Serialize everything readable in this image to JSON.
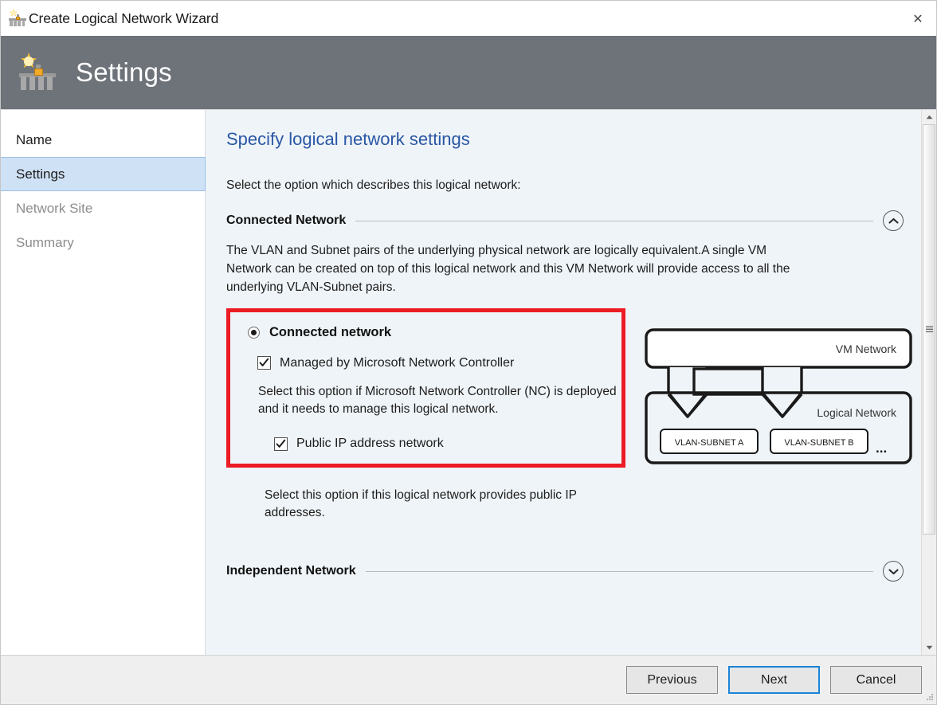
{
  "window": {
    "title": "Create Logical Network Wizard",
    "app_icon": "network-wizard-icon",
    "close_label": "✕"
  },
  "header": {
    "title": "Settings",
    "icon": "network-wizard-icon"
  },
  "sidebar": {
    "items": [
      {
        "label": "Name",
        "state": "enabled"
      },
      {
        "label": "Settings",
        "state": "selected"
      },
      {
        "label": "Network Site",
        "state": "disabled"
      },
      {
        "label": "Summary",
        "state": "disabled"
      }
    ]
  },
  "main": {
    "page_title": "Specify logical network settings",
    "intro": "Select the option which describes this logical network:",
    "connected_section": {
      "heading": "Connected Network",
      "collapse_icon": "chevron-up-icon",
      "description": "The VLAN and Subnet pairs of the underlying physical network are logically equivalent.A single VM Network can be created on top of this logical network and this VM Network will provide access to all the underlying VLAN-Subnet pairs.",
      "radio": {
        "label": "Connected network",
        "checked": true
      },
      "checkbox_managed": {
        "label": "Managed by Microsoft Network Controller",
        "checked": true
      },
      "managed_hint": "Select this option if Microsoft Network Controller (NC) is deployed and it needs to manage this logical network.",
      "checkbox_public_ip": {
        "label": "Public IP address network",
        "checked": true
      },
      "public_ip_hint": "Select this option if this logical network provides public IP addresses.",
      "highlight_color": "#ec1c24"
    },
    "independent_section": {
      "heading": "Independent Network",
      "expand_icon": "chevron-down-icon"
    },
    "diagram": {
      "vm_network_label": "VM Network",
      "logical_network_label": "Logical  Network",
      "subnet_a_label": "VLAN-SUBNET A",
      "subnet_b_label": "VLAN-SUBNET B",
      "ellipsis": "..."
    }
  },
  "footer": {
    "previous": "Previous",
    "next": "Next",
    "cancel": "Cancel"
  }
}
